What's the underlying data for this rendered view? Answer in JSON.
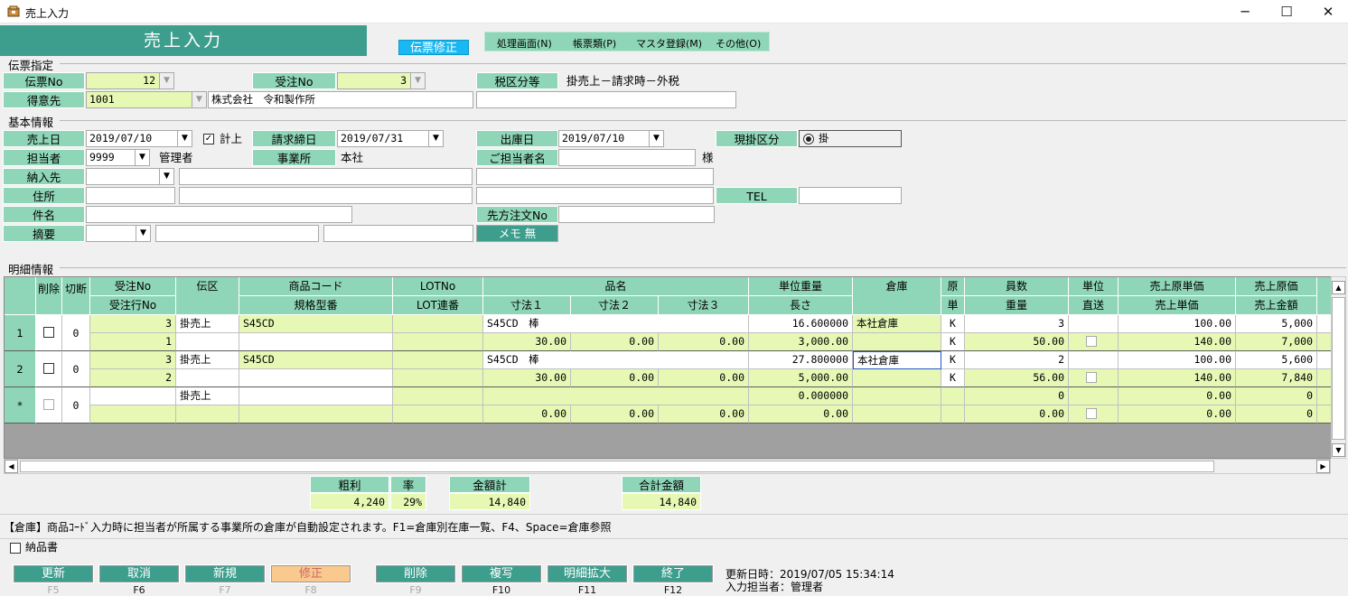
{
  "window": {
    "title": "売上入力",
    "minimize": "─",
    "maximize": "☐",
    "close": "✕"
  },
  "banner": {
    "title": "売上入力",
    "mode": "伝票修正"
  },
  "menu": [
    "処理画面(N)",
    "帳票類(P)",
    "マスタ登録(M)",
    "その他(O)"
  ],
  "slip": {
    "section": "伝票指定",
    "no_label": "伝票No",
    "no_value": "12",
    "order_label": "受注No",
    "order_value": "3",
    "tax_label": "税区分等",
    "tax_value": "掛売上－請求時－外税",
    "customer_label": "得意先",
    "customer_code": "1001",
    "customer_name": "株式会社　令和製作所"
  },
  "basic": {
    "section": "基本情報",
    "sale_date_label": "売上日",
    "sale_date": "2019/07/10",
    "record_label": "計上",
    "bill_close_label": "請求締日",
    "bill_close": "2019/07/31",
    "ship_date_label": "出庫日",
    "ship_date": "2019/07/10",
    "cash_label": "現掛区分",
    "cash_value": "掛",
    "staff_label": "担当者",
    "staff_code": "9999",
    "staff_name": "管理者",
    "office_label": "事業所",
    "office_value": "本社",
    "contact_label": "ご担当者名",
    "contact_suffix": "様",
    "delivery_label": "納入先",
    "address_label": "住所",
    "tel_label": "TEL",
    "subject_label": "件名",
    "cust_order_label": "先方注文No",
    "memo_label": "摘要",
    "memo_button": "メモ 無"
  },
  "detail": {
    "section": "明細情報",
    "headers_top": [
      "削除",
      "切断",
      "受注No",
      "伝区",
      "商品コード",
      "LOTNo",
      "品名",
      "単位重量",
      "倉庫",
      "原",
      "員数",
      "単位",
      "売上原単価",
      "売上原価"
    ],
    "headers_bottom": [
      "受注行No",
      "規格型番",
      "LOT連番",
      "寸法１",
      "寸法２",
      "寸法３",
      "長さ",
      "単",
      "重量",
      "直送",
      "売上単価",
      "売上金額"
    ],
    "rows": [
      {
        "num": "1",
        "cut": "0",
        "order_no": "3",
        "kubun": "掛売上",
        "code": "S45CD",
        "hinmei": "S45CD　棒",
        "unit_weight": "16.600000",
        "warehouse": "本社倉庫",
        "gen": "K",
        "qty": "3",
        "cost_unit": "100.00",
        "cost": "5,000",
        "order_line": "1",
        "dim1": "30.00",
        "dim2": "0.00",
        "dim3": "0.00",
        "length": "3,000.00",
        "tan": "K",
        "weight": "50.00",
        "sale_unit": "140.00",
        "amount": "7,000"
      },
      {
        "num": "2",
        "cut": "0",
        "order_no": "3",
        "kubun": "掛売上",
        "code": "S45CD",
        "hinmei": "S45CD　棒",
        "unit_weight": "27.800000",
        "warehouse": "本社倉庫",
        "gen": "K",
        "qty": "2",
        "cost_unit": "100.00",
        "cost": "5,600",
        "order_line": "2",
        "dim1": "30.00",
        "dim2": "0.00",
        "dim3": "0.00",
        "length": "5,000.00",
        "tan": "K",
        "weight": "56.00",
        "sale_unit": "140.00",
        "amount": "7,840"
      },
      {
        "num": "*",
        "cut": "0",
        "order_no": "",
        "kubun": "掛売上",
        "code": "",
        "hinmei": "",
        "unit_weight": "0.000000",
        "warehouse": "",
        "gen": "",
        "qty": "0",
        "cost_unit": "0.00",
        "cost": "0",
        "order_line": "",
        "dim1": "0.00",
        "dim2": "0.00",
        "dim3": "0.00",
        "length": "0.00",
        "tan": "",
        "weight": "0.00",
        "sale_unit": "0.00",
        "amount": "0"
      }
    ]
  },
  "totals": {
    "profit_label": "粗利",
    "profit": "4,240",
    "rate_label": "率",
    "rate": "29%",
    "sum_label": "金額計",
    "sum": "14,840",
    "grand_label": "合計金額",
    "grand": "14,840"
  },
  "hint": "【倉庫】商品ｺｰﾄﾞ入力時に担当者が所属する事業所の倉庫が自動設定されます。F1=倉庫別在庫一覧、F4、Space=倉庫参照",
  "delivery_note": "納品書",
  "buttons": [
    {
      "label": "更新",
      "key": "F5"
    },
    {
      "label": "取消",
      "key": "F6"
    },
    {
      "label": "新規",
      "key": "F7"
    },
    {
      "label": "修正",
      "key": "F8"
    },
    {
      "label": "削除",
      "key": "F9"
    },
    {
      "label": "複写",
      "key": "F10"
    },
    {
      "label": "明細拡大",
      "key": "F11"
    },
    {
      "label": "終了",
      "key": "F12"
    }
  ],
  "footer": {
    "updated": "更新日時：2019/07/05 15:34:14",
    "operator": "入力担当者：管理者"
  }
}
